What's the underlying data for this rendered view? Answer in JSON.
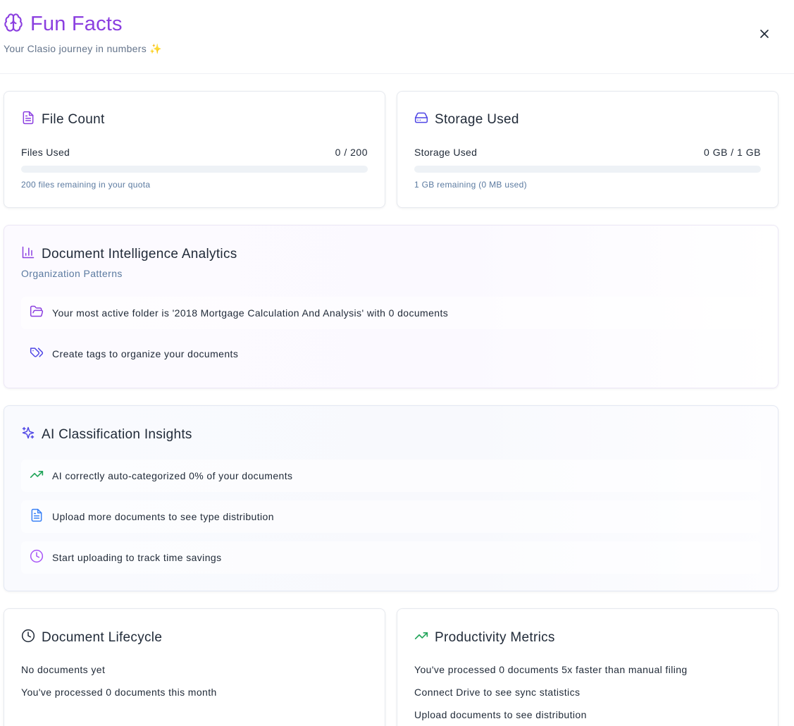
{
  "header": {
    "title": "Fun Facts",
    "subtitle": "Your Clasio journey in numbers",
    "subtitle_emoji": "✨",
    "close_label": "×"
  },
  "file_count": {
    "title": "File Count",
    "label": "Files Used",
    "value": "0 / 200",
    "progress": 0,
    "hint": "200 files remaining in your quota"
  },
  "storage": {
    "title": "Storage Used",
    "label": "Storage Used",
    "value": "0 GB / 1 GB",
    "progress": 0,
    "hint": "1 GB remaining (0 MB used)"
  },
  "analytics": {
    "title": "Document Intelligence Analytics",
    "subtitle": "Organization Patterns",
    "items": [
      {
        "icon": "folder-open-icon",
        "text": "Your most active folder is '2018 Mortgage Calculation And Analysis' with 0 documents"
      },
      {
        "icon": "tags-icon",
        "text": "Create tags to organize your documents"
      }
    ]
  },
  "ai_insights": {
    "title": "AI Classification Insights",
    "items": [
      {
        "icon": "trending-up-icon",
        "text": "AI correctly auto-categorized 0% of your documents"
      },
      {
        "icon": "file-text-icon",
        "text": "Upload more documents to see type distribution"
      },
      {
        "icon": "clock-icon",
        "text": "Start uploading to track time savings"
      }
    ]
  },
  "lifecycle": {
    "title": "Document Lifecycle",
    "lines": [
      "No documents yet",
      "You've processed 0 documents this month"
    ]
  },
  "productivity": {
    "title": "Productivity Metrics",
    "lines": [
      "You've processed 0 documents 5x faster than manual filing",
      "Connect Drive to see sync statistics",
      "Upload documents to see distribution"
    ]
  },
  "colors": {
    "accent": "#8b3fe0",
    "blue": "#4f46e5",
    "green": "#22a55a",
    "muted": "#5b7aa0"
  }
}
